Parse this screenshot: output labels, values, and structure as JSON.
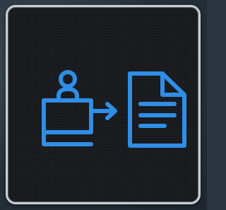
{
  "app_icon": {
    "icon_name": "check-in-to-document-icon",
    "accent_color": "#2f8ee6",
    "tile_color": "#17191c",
    "border_color": "#c9cdd1"
  }
}
